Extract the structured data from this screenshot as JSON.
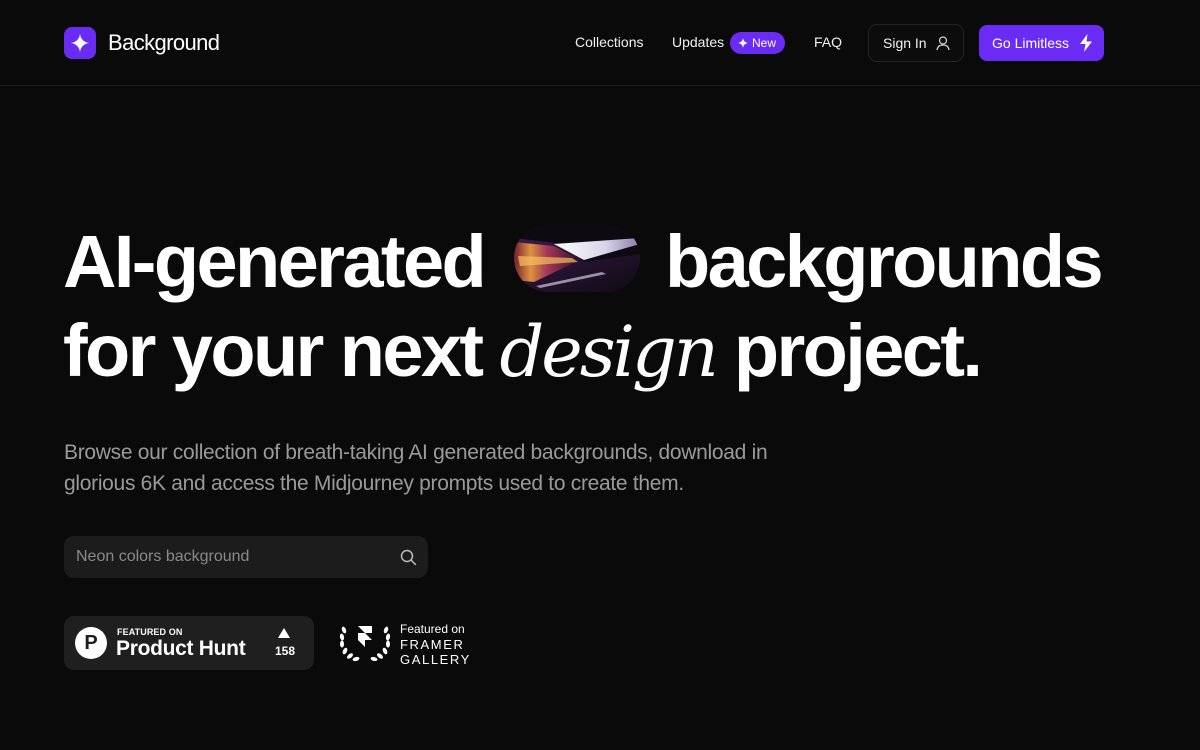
{
  "brand": {
    "name": "Background",
    "logo_icon": "sparkle-icon",
    "accent_color": "#6a2cf5"
  },
  "nav": {
    "links": [
      {
        "label": "Collections"
      },
      {
        "label": "Updates"
      },
      {
        "label": "FAQ"
      }
    ],
    "updates_badge": {
      "icon": "sparkle-icon",
      "label": "New"
    },
    "sign_in": {
      "label": "Sign In",
      "icon": "user-icon"
    },
    "cta": {
      "label": "Go Limitless",
      "icon": "lightning-icon"
    }
  },
  "hero": {
    "line1_start": "AI-generated",
    "line1_end": "backgrounds",
    "line2_start": "for your next",
    "line2_italic": "design",
    "line2_end": "project.",
    "pill_image": "abstract-neon-streak-thumbnail",
    "subtitle": "Browse our collection of breath-taking AI generated backgrounds, download in glorious 6K and access the Midjourney prompts used to create them."
  },
  "search": {
    "placeholder": "Neon colors background",
    "value": "",
    "icon": "search-icon"
  },
  "badges": {
    "product_hunt": {
      "small": "FEATURED ON",
      "big": "Product Hunt",
      "logo_letter": "P",
      "upvotes": "158"
    },
    "framer": {
      "small": "Featured on",
      "line1": "FRAMER",
      "line2": "GALLERY"
    }
  }
}
